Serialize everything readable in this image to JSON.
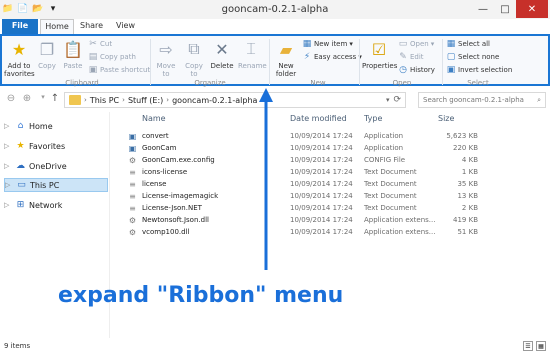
{
  "window": {
    "title": "gooncam-0.2.1-alpha"
  },
  "tabs": [
    "File",
    "Home",
    "Share",
    "View"
  ],
  "ribbon": {
    "clipboard": {
      "group": "Clipboard",
      "add_favorites": "Add to favorites",
      "copy": "Copy",
      "paste": "Paste",
      "cut": "Cut",
      "copy_path": "Copy path",
      "paste_shortcut": "Paste shortcut"
    },
    "organize": {
      "group": "Organize",
      "move_to": "Move to",
      "copy_to": "Copy to",
      "delete": "Delete",
      "rename": "Rename"
    },
    "new": {
      "group": "New",
      "new_folder": "New folder",
      "new_item": "New item",
      "easy_access": "Easy access"
    },
    "open": {
      "group": "Open",
      "properties": "Properties",
      "open": "Open",
      "edit": "Edit",
      "history": "History"
    },
    "select": {
      "group": "Select",
      "select_all": "Select all",
      "select_none": "Select none",
      "invert": "Invert selection"
    }
  },
  "address": {
    "crumbs": [
      "This PC",
      "Stuff (E:)",
      "gooncam-0.2.1-alpha"
    ],
    "search_placeholder": "Search gooncam-0.2.1-alpha"
  },
  "nav": [
    {
      "label": "Home",
      "icon": "home-icon"
    },
    {
      "label": "Favorites",
      "icon": "star-icon"
    },
    {
      "label": "OneDrive",
      "icon": "cloud-icon"
    },
    {
      "label": "This PC",
      "icon": "computer-icon"
    },
    {
      "label": "Network",
      "icon": "network-icon"
    }
  ],
  "columns": [
    "Name",
    "Date modified",
    "Type",
    "Size"
  ],
  "files": [
    {
      "name": "convert",
      "date": "10/09/2014 17:24",
      "type": "Application",
      "size": "5,623 KB",
      "icon": "app-icon"
    },
    {
      "name": "GoonCam",
      "date": "10/09/2014 17:24",
      "type": "Application",
      "size": "220 KB",
      "icon": "app-icon"
    },
    {
      "name": "GoonCam.exe.config",
      "date": "10/09/2014 17:24",
      "type": "CONFIG File",
      "size": "4 KB",
      "icon": "config-icon"
    },
    {
      "name": "icons-license",
      "date": "10/09/2014 17:24",
      "type": "Text Document",
      "size": "1 KB",
      "icon": "text-icon"
    },
    {
      "name": "license",
      "date": "10/09/2014 17:24",
      "type": "Text Document",
      "size": "35 KB",
      "icon": "text-icon"
    },
    {
      "name": "License-imagemagick",
      "date": "10/09/2014 17:24",
      "type": "Text Document",
      "size": "13 KB",
      "icon": "text-icon"
    },
    {
      "name": "License-Json.NET",
      "date": "10/09/2014 17:24",
      "type": "Text Document",
      "size": "2 KB",
      "icon": "text-icon"
    },
    {
      "name": "Newtonsoft.Json.dll",
      "date": "10/09/2014 17:24",
      "type": "Application extens...",
      "size": "419 KB",
      "icon": "dll-icon"
    },
    {
      "name": "vcomp100.dll",
      "date": "10/09/2014 17:24",
      "type": "Application extens...",
      "size": "51 KB",
      "icon": "dll-icon"
    }
  ],
  "status": {
    "items": "9 items"
  },
  "annotation": {
    "text": "expand \"Ribbon\" menu"
  }
}
